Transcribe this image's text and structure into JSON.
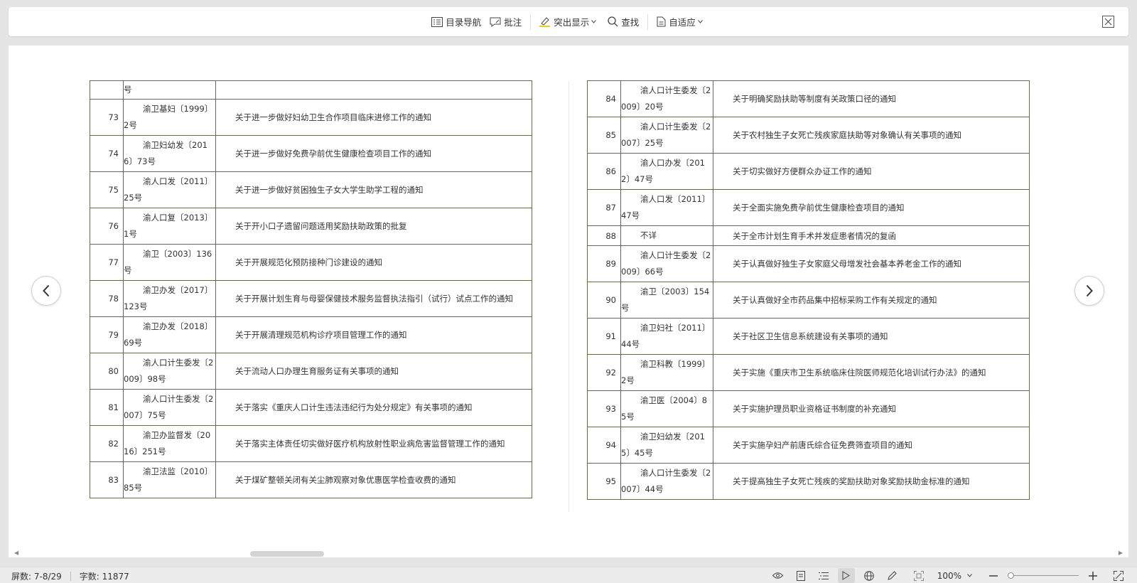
{
  "toolbar": {
    "toc_label": "目录导航",
    "comment_label": "批注",
    "highlight_label": "突出显示",
    "find_label": "查找",
    "fit_label": "自适应"
  },
  "left_table": {
    "cont_no": "号",
    "rows": [
      {
        "num": "73",
        "doc": "渝卫基妇〔1999〕2号",
        "title": "关于进一步做好妇幼卫生合作项目临床进修工作的通知"
      },
      {
        "num": "74",
        "doc": "渝卫妇幼发〔2016〕73号",
        "title": "关于进一步做好免费孕前优生健康检查项目工作的通知"
      },
      {
        "num": "75",
        "doc": "渝人口发〔2011〕25号",
        "title": "关于进一步做好贫困独生子女大学生助学工程的通知"
      },
      {
        "num": "76",
        "doc": "渝人口复〔2013〕1号",
        "title": "关于开小口子遗留问题适用奖励扶助政策的批复"
      },
      {
        "num": "77",
        "doc": "渝卫〔2003〕136号",
        "title": "关于开展规范化预防接种门诊建设的通知"
      },
      {
        "num": "78",
        "doc": "渝卫办发〔2017〕123号",
        "title": "关于开展计划生育与母婴保健技术服务监督执法指引（试行）试点工作的通知"
      },
      {
        "num": "79",
        "doc": "渝卫办发〔2018〕69号",
        "title": "关于开展清理规范机构诊疗项目管理工作的通知"
      },
      {
        "num": "80",
        "doc": "渝人口计生委发〔2009〕98号",
        "title": "关于流动人口办理生育服务证有关事项的通知"
      },
      {
        "num": "81",
        "doc": "渝人口计生委发〔2007〕75号",
        "title": "关于落实《重庆人口计生违法违纪行为处分规定》有关事项的通知"
      },
      {
        "num": "82",
        "doc": "渝卫办监督发〔2016〕251号",
        "title": "关于落实主体责任切实做好医疗机构放射性职业病危害监督管理工作的通知"
      },
      {
        "num": "83",
        "doc": "渝卫法监〔2010〕85号",
        "title": "关于煤矿整顿关闭有关尘肺观察对象优惠医学检查收费的通知"
      }
    ]
  },
  "right_table": {
    "rows": [
      {
        "num": "84",
        "doc": "渝人口计生委发〔2009〕20号",
        "title": "关于明确奖励扶助等制度有关政策口径的通知"
      },
      {
        "num": "85",
        "doc": "渝人口计生委发〔2007〕25号",
        "title": "关于农村独生子女死亡残疾家庭扶助等对象确认有关事项的通知"
      },
      {
        "num": "86",
        "doc": "渝人口办发〔2012〕47号",
        "title": "关于切实做好方便群众办证工作的通知"
      },
      {
        "num": "87",
        "doc": "渝人口发〔2011〕47号",
        "title": "关于全面实施免费孕前优生健康检查项目的通知"
      },
      {
        "num": "88",
        "doc": "不详",
        "title": "关于全市计划生育手术并发症患者情况的复函"
      },
      {
        "num": "89",
        "doc": "渝人口计生委发〔2009〕66号",
        "title": "关于认真做好独生子女家庭父母增发社会基本养老金工作的通知"
      },
      {
        "num": "90",
        "doc": "渝卫〔2003〕154号",
        "title": "关于认真做好全市药品集中招标采购工作有关规定的通知"
      },
      {
        "num": "91",
        "doc": "渝卫妇社〔2011〕44号",
        "title": "关于社区卫生信息系统建设有关事项的通知"
      },
      {
        "num": "92",
        "doc": "渝卫科教〔1999〕2号",
        "title": "关于实施《重庆市卫生系统临床住院医师规范化培训试行办法》的通知"
      },
      {
        "num": "93",
        "doc": "渝卫医〔2004〕85号",
        "title": "关于实施护理员职业资格证书制度的补充通知"
      },
      {
        "num": "94",
        "doc": "渝卫妇幼发〔2015〕45号",
        "title": "关于实施孕妇产前唐氏综合征免费筛查项目的通知"
      },
      {
        "num": "95",
        "doc": "渝人口计生委发〔2007〕44号",
        "title": "关于提高独生子女死亡残疾的奖励扶助对象奖励扶助金标准的通知"
      }
    ]
  },
  "status": {
    "screens": "屏数: 7-8/29",
    "words": "字数: 11877",
    "zoom": "100%",
    "zoom_fraction": 0.0
  },
  "colors": {
    "table_border": "#6a6650",
    "accent_highlight": "#f5d000"
  }
}
